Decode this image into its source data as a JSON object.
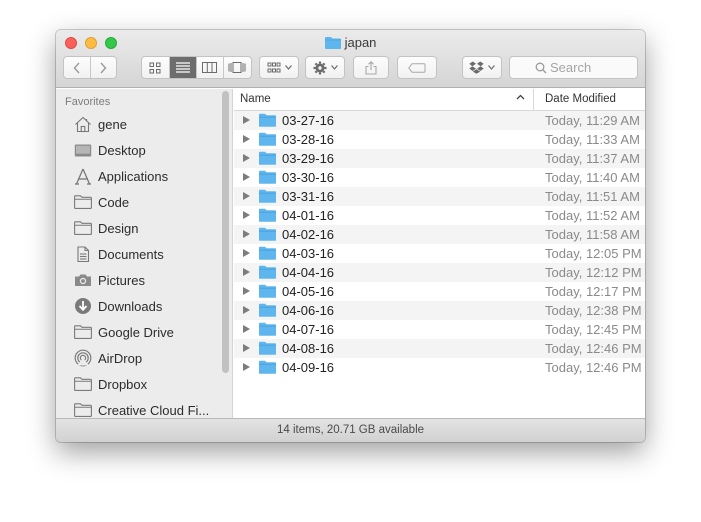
{
  "window": {
    "title": "japan"
  },
  "toolbar": {
    "search_placeholder": "Search",
    "colors": {
      "accent_folder": "#5fb6ee"
    }
  },
  "sidebar": {
    "heading": "Favorites",
    "items": [
      {
        "label": "gene",
        "icon": "home-icon"
      },
      {
        "label": "Desktop",
        "icon": "desktop-icon"
      },
      {
        "label": "Applications",
        "icon": "applications-icon"
      },
      {
        "label": "Code",
        "icon": "folder-icon"
      },
      {
        "label": "Design",
        "icon": "folder-icon"
      },
      {
        "label": "Documents",
        "icon": "documents-icon"
      },
      {
        "label": "Pictures",
        "icon": "camera-icon"
      },
      {
        "label": "Downloads",
        "icon": "download-icon"
      },
      {
        "label": "Google Drive",
        "icon": "folder-icon"
      },
      {
        "label": "AirDrop",
        "icon": "airdrop-icon"
      },
      {
        "label": "Dropbox",
        "icon": "folder-icon"
      },
      {
        "label": "Creative Cloud Fi...",
        "icon": "folder-icon"
      }
    ]
  },
  "columns": {
    "name": "Name",
    "date": "Date Modified"
  },
  "files": [
    {
      "name": "03-27-16",
      "date": "Today, 11:29 AM"
    },
    {
      "name": "03-28-16",
      "date": "Today, 11:33 AM"
    },
    {
      "name": "03-29-16",
      "date": "Today, 11:37 AM"
    },
    {
      "name": "03-30-16",
      "date": "Today, 11:40 AM"
    },
    {
      "name": "03-31-16",
      "date": "Today, 11:51 AM"
    },
    {
      "name": "04-01-16",
      "date": "Today, 11:52 AM"
    },
    {
      "name": "04-02-16",
      "date": "Today, 11:58 AM"
    },
    {
      "name": "04-03-16",
      "date": "Today, 12:05 PM"
    },
    {
      "name": "04-04-16",
      "date": "Today, 12:12 PM"
    },
    {
      "name": "04-05-16",
      "date": "Today, 12:17 PM"
    },
    {
      "name": "04-06-16",
      "date": "Today, 12:38 PM"
    },
    {
      "name": "04-07-16",
      "date": "Today, 12:45 PM"
    },
    {
      "name": "04-08-16",
      "date": "Today, 12:46 PM"
    },
    {
      "name": "04-09-16",
      "date": "Today, 12:46 PM"
    }
  ],
  "status": {
    "text": "14 items, 20.71 GB available"
  }
}
